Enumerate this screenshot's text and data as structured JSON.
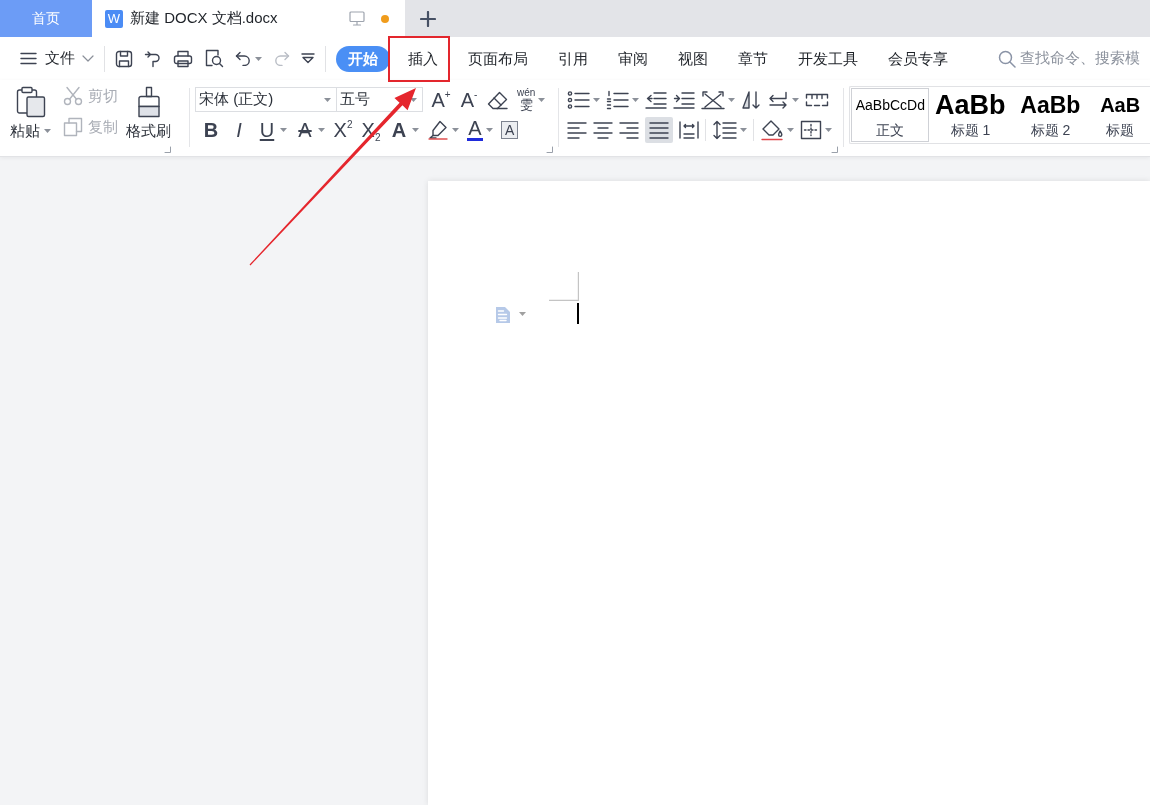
{
  "title_bar": {
    "tabs": [
      {
        "kind": "home",
        "label": "首页",
        "selected": false
      },
      {
        "kind": "document",
        "badge": "W",
        "label": "新建 DOCX 文档.docx",
        "selected": true,
        "modified": true
      }
    ]
  },
  "menu_bar": {
    "file_menu": "文件",
    "quick_access": [
      {
        "kind": "save",
        "disabled": false,
        "dropdown": false
      },
      {
        "kind": "export",
        "disabled": false,
        "dropdown": false
      },
      {
        "kind": "print",
        "disabled": false,
        "dropdown": false
      },
      {
        "kind": "preview",
        "disabled": false,
        "dropdown": false
      },
      {
        "kind": "undo",
        "disabled": false,
        "dropdown": true
      },
      {
        "kind": "redo",
        "disabled": true,
        "dropdown": false
      },
      {
        "kind": "customize",
        "disabled": false,
        "dropdown": false
      }
    ],
    "tabs": [
      {
        "label": "开始",
        "selected": true,
        "highlighted": false
      },
      {
        "label": "插入",
        "selected": false,
        "highlighted": true
      },
      {
        "label": "页面布局",
        "selected": false,
        "highlighted": false
      },
      {
        "label": "引用",
        "selected": false,
        "highlighted": false
      },
      {
        "label": "审阅",
        "selected": false,
        "highlighted": false
      },
      {
        "label": "视图",
        "selected": false,
        "highlighted": false
      },
      {
        "label": "章节",
        "selected": false,
        "highlighted": false
      },
      {
        "label": "开发工具",
        "selected": false,
        "highlighted": false
      },
      {
        "label": "会员专享",
        "selected": false,
        "highlighted": false
      }
    ],
    "search": {
      "placeholder": "查找命令、搜索模"
    }
  },
  "ribbon": {
    "clipboard": {
      "paste": {
        "label": "粘贴",
        "dropdown": true
      },
      "cut": {
        "label": "剪切",
        "disabled": true
      },
      "copy": {
        "label": "复制",
        "disabled": true
      },
      "format_painter": {
        "label": "格式刷"
      }
    },
    "font": {
      "font_name": "宋体 (正文)",
      "font_size": "五号",
      "row_1": [
        {
          "kind": "grow",
          "text": "A$^{+}$",
          "dropdown": false
        },
        {
          "kind": "shrink",
          "text": "A$^{-}$",
          "dropdown": false
        },
        {
          "kind": "clear",
          "dropdown": false
        },
        {
          "kind": "pinyin",
          "ruby": "wén",
          "text": "雯",
          "dropdown": true
        }
      ],
      "row_2": [
        {
          "kind": "bold",
          "text": "B",
          "dropdown": false
        },
        {
          "kind": "italic",
          "text": "I",
          "dropdown": false
        },
        {
          "kind": "underline",
          "text": "U",
          "dropdown": true
        },
        {
          "kind": "strike",
          "text": "A",
          "dropdown": true
        },
        {
          "kind": "superscript",
          "text": "X$^{2}$",
          "dropdown": false
        },
        {
          "kind": "subscript",
          "text": "X$_{2}$",
          "dropdown": false
        },
        {
          "kind": "effect",
          "text": "A",
          "dropdown": true
        },
        {
          "kind": "highlight",
          "dropdown": true
        },
        {
          "kind": "font_color",
          "text": "A",
          "color": "#1f2bdb",
          "dropdown": true
        },
        {
          "kind": "char_border",
          "text": "A",
          "dropdown": false
        }
      ]
    },
    "paragraph": {
      "row_1": [
        {
          "kind": "bullets",
          "dropdown": true
        },
        {
          "kind": "numbering",
          "dropdown": true
        },
        {
          "kind": "outdent",
          "dropdown": false
        },
        {
          "kind": "indent",
          "dropdown": false
        },
        {
          "kind": "chinese_layout",
          "dropdown": true
        },
        {
          "kind": "sort",
          "dropdown": false
        },
        {
          "kind": "marks",
          "dropdown": true
        },
        {
          "kind": "tab_stops",
          "dropdown": false
        }
      ],
      "alignment": [
        {
          "kind": "left",
          "selected": false
        },
        {
          "kind": "center",
          "selected": false
        },
        {
          "kind": "right",
          "selected": false
        },
        {
          "kind": "justify",
          "selected": true
        },
        {
          "kind": "distribute",
          "selected": false
        }
      ],
      "row_2": [
        {
          "kind": "line_spacing",
          "dropdown": true
        },
        {
          "kind": "shading",
          "dropdown": true
        },
        {
          "kind": "borders",
          "dropdown": true
        }
      ]
    },
    "styles": [
      {
        "kind": "body",
        "preview": "AaBbCcDd",
        "label": "正文",
        "selected": true
      },
      {
        "kind": "heading_1",
        "preview": "AaBb",
        "label": "标题 1",
        "selected": false
      },
      {
        "kind": "heading_2",
        "preview": "AaBb",
        "label": "标题 2",
        "selected": false
      },
      {
        "kind": "heading_3",
        "preview": "AaB",
        "label": "标题",
        "selected": false
      }
    ]
  }
}
